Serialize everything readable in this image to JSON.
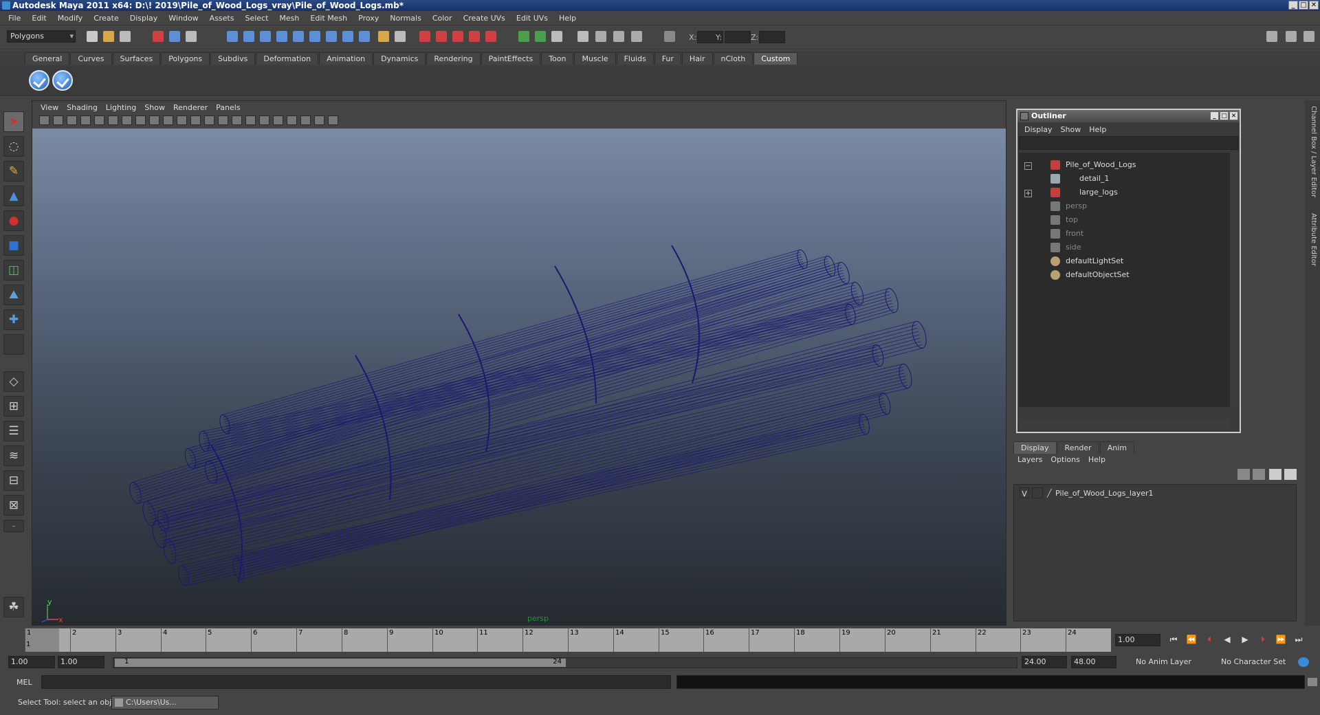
{
  "window": {
    "title": "Autodesk Maya 2011 x64: D:\\! 2019\\Pile_of_Wood_Logs_vray\\Pile_of_Wood_Logs.mb*"
  },
  "menubar": [
    "File",
    "Edit",
    "Modify",
    "Create",
    "Display",
    "Window",
    "Assets",
    "Select",
    "Mesh",
    "Edit Mesh",
    "Proxy",
    "Normals",
    "Color",
    "Create UVs",
    "Edit UVs",
    "Help"
  ],
  "statusline": {
    "mode": "Polygons",
    "x_label": "X:",
    "y_label": "Y:",
    "z_label": "Z:"
  },
  "shelf": {
    "tabs": [
      "General",
      "Curves",
      "Surfaces",
      "Polygons",
      "Subdivs",
      "Deformation",
      "Animation",
      "Dynamics",
      "Rendering",
      "PaintEffects",
      "Toon",
      "Muscle",
      "Fluids",
      "Fur",
      "Hair",
      "nCloth",
      "Custom"
    ],
    "active_tab": "Custom"
  },
  "viewport": {
    "menu": [
      "View",
      "Shading",
      "Lighting",
      "Show",
      "Renderer",
      "Panels"
    ],
    "camera_label": "persp",
    "axis_y": "y",
    "axis_x": "x",
    "wire_color": "#1a1870"
  },
  "outliner": {
    "title": "Outliner",
    "menu": [
      "Display",
      "Show",
      "Help"
    ],
    "items": [
      {
        "label": "Pile_of_Wood_Logs",
        "dim": false,
        "icon": "transform-icon"
      },
      {
        "label": "detail_1",
        "dim": false,
        "icon": "mesh-icon"
      },
      {
        "label": "large_logs",
        "dim": false,
        "icon": "transform-icon"
      },
      {
        "label": "persp",
        "dim": true,
        "icon": "camera-icon"
      },
      {
        "label": "top",
        "dim": true,
        "icon": "camera-icon"
      },
      {
        "label": "front",
        "dim": true,
        "icon": "camera-icon"
      },
      {
        "label": "side",
        "dim": true,
        "icon": "camera-icon"
      },
      {
        "label": "defaultLightSet",
        "dim": false,
        "icon": "set-icon"
      },
      {
        "label": "defaultObjectSet",
        "dim": false,
        "icon": "set-icon"
      }
    ],
    "expander_open": "−",
    "expander_closed": "+"
  },
  "channelbox_label": "Channel Box / Layer Editor",
  "layers": {
    "tabs": [
      "Display",
      "Render",
      "Anim"
    ],
    "active_tab": "Display",
    "menu": [
      "Layers",
      "Options",
      "Help"
    ],
    "rows": [
      {
        "visible": "V",
        "name": "Pile_of_Wood_Logs_layer1"
      }
    ]
  },
  "sidetabs": [
    "Channel Box / Layer Editor",
    "Attribute Editor"
  ],
  "timeslider": {
    "ticks": [
      "1",
      "2",
      "3",
      "4",
      "5",
      "6",
      "7",
      "8",
      "9",
      "10",
      "11",
      "12",
      "13",
      "14",
      "15",
      "16",
      "17",
      "18",
      "19",
      "20",
      "21",
      "22",
      "23",
      "24"
    ],
    "current_frame_label": "1",
    "current_time": "1.00"
  },
  "range": {
    "start": "1.00",
    "playback_start": "1.00",
    "handle_start": "1",
    "handle_end": "24",
    "playback_end": "24.00",
    "end": "48.00",
    "anim_layer": "No Anim Layer",
    "character_set": "No Character Set"
  },
  "cmdline": {
    "label": "MEL"
  },
  "helpline": {
    "text": "Select Tool: select an object",
    "task": "C:\\Users\\Us..."
  }
}
